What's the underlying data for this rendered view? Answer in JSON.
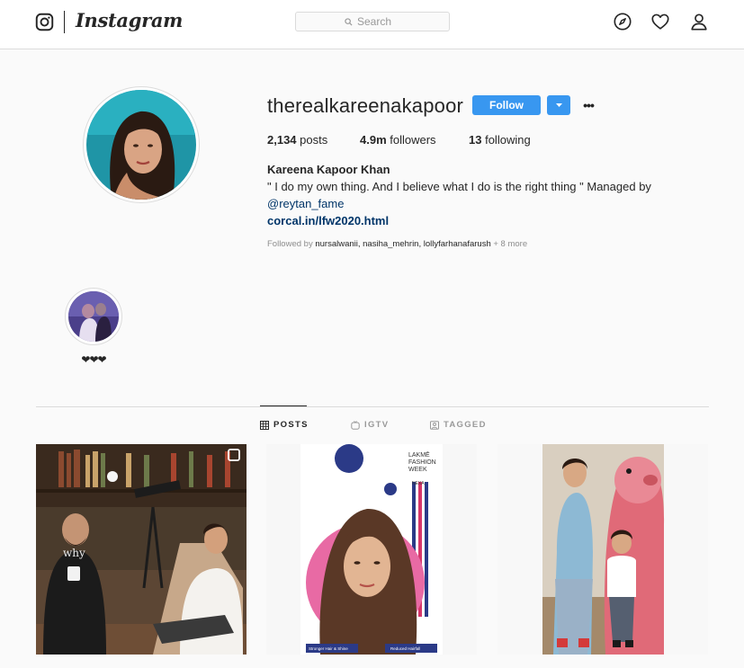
{
  "nav": {
    "logo_text": "Instagram",
    "search_placeholder": "Search",
    "icons": [
      "instagram-glyph-icon",
      "search-icon",
      "compass-icon",
      "heart-icon",
      "user-icon"
    ]
  },
  "profile": {
    "username": "therealkareenakapoor",
    "follow_label": "Follow",
    "stats": [
      {
        "count": "2,134",
        "label": "posts"
      },
      {
        "count": "4.9m",
        "label": "followers"
      },
      {
        "count": "13",
        "label": "following"
      }
    ],
    "full_name": "Kareena Kapoor Khan",
    "bio": "\" I do my own thing. And I believe what I do is the right thing \" Managed by",
    "mention": "@reytan_fame",
    "link": "corcal.in/lfw2020.html",
    "followed_by_prefix": "Followed by",
    "followed_by_names": "nursalwanii, nasiha_mehrin, lollyfarhanafarush",
    "followed_by_more": "+ 8 more"
  },
  "highlight": {
    "label": "❤❤❤"
  },
  "tabs": [
    {
      "label": "POSTS",
      "icon": "grid-icon",
      "active": true
    },
    {
      "label": "IGTV",
      "icon": "igtv-icon",
      "active": false
    },
    {
      "label": "TAGGED",
      "icon": "tag-icon",
      "active": false
    }
  ],
  "posts": {
    "post2_poster_lines": [
      "LAKMĒ",
      "FASHION",
      "WEEK"
    ],
    "post2_poster_sub": "NEXA",
    "post2_caption_left": "Stronger Hair & Shine",
    "post2_caption_right": "Reduced Hairfall",
    "post1_shirt_text": "why"
  },
  "colors": {
    "accent": "#3897f0",
    "link": "#003569",
    "muted": "#8e8e8e"
  }
}
